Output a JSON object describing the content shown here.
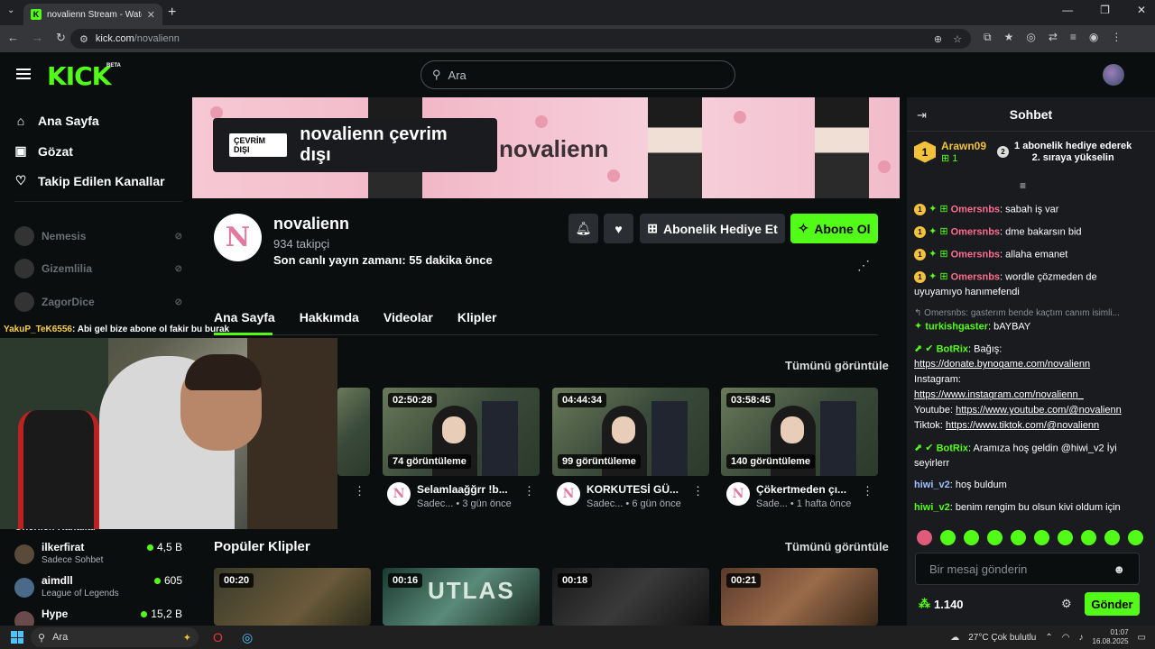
{
  "browser": {
    "tab_title": "novalienn Stream - Watch Live",
    "url_domain": "kick.com",
    "url_path": "/novalienn"
  },
  "header": {
    "logo": "KICK",
    "beta": "BETA",
    "search_placeholder": "Ara"
  },
  "sidebar": {
    "nav": [
      {
        "label": "Ana Sayfa",
        "icon": "home-icon"
      },
      {
        "label": "Gözat",
        "icon": "browse-icon"
      },
      {
        "label": "Takip Edilen Kanallar",
        "icon": "heart-icon"
      }
    ],
    "offline_channels": [
      "Nemesis",
      "Gizemlilia",
      "ZagorDice"
    ],
    "recommended_header": "Önerilen Kanallar",
    "recommended": [
      {
        "name": "ilkerfirat",
        "category": "Sadece Sohbet",
        "viewers": "4,5 B"
      },
      {
        "name": "aimdll",
        "category": "League of Legends",
        "viewers": "605"
      },
      {
        "name": "Hype",
        "category": "",
        "viewers": "15,2 B"
      }
    ]
  },
  "webcam_caption": {
    "user": "YakuP_TeK6556",
    "message": ": Abi gel bize abone ol fakir bu burak"
  },
  "banner": {
    "offline_badge": "ÇEVRİM DIŞI",
    "offline_text": "novalienn çevrim dışı",
    "watermark": "novalienn"
  },
  "profile": {
    "name": "novalienn",
    "followers": "934 takipçi",
    "last_live": "Son canlı yayın zamanı: 55 dakika önce",
    "gift_button": "Abonelik Hediye Et",
    "subscribe_button": "Abone Ol"
  },
  "tabs": [
    "Ana Sayfa",
    "Hakkımda",
    "Videolar",
    "Klipler"
  ],
  "videos_section": {
    "see_all": "Tümünü görüntüle",
    "items": [
      {
        "duration": "02:50:28",
        "views": "74 görüntüleme",
        "title": "Selamlaağğrr !b...",
        "channel": "Sadec...",
        "age": "• 3 gün önce"
      },
      {
        "duration": "04:44:34",
        "views": "99 görüntüleme",
        "title": "KORKUTESİ GÜ...",
        "channel": "Sadec...",
        "age": "• 6 gün önce"
      },
      {
        "duration": "03:58:45",
        "views": "140 görüntüleme",
        "title": "Çökertmeden çı...",
        "channel": "Sade...",
        "age": "• 1 hafta önce"
      }
    ]
  },
  "clips_section": {
    "title": "Popüler Klipler",
    "see_all": "Tümünü görüntüle",
    "items": [
      {
        "duration": "00:20"
      },
      {
        "duration": "00:16"
      },
      {
        "duration": "00:18"
      },
      {
        "duration": "00:21"
      }
    ]
  },
  "chat": {
    "title": "Sohbet",
    "pinned": {
      "user": "Arawn09",
      "count": "1",
      "rank": "2",
      "message_line1": "1 abonelik hediye ederek",
      "message_line2": "2. sıraya yükselin"
    },
    "messages": [
      {
        "user": "Omersnbs",
        "text": ": sabah iş var"
      },
      {
        "user": "Omersnbs",
        "text": ": dme bakarsın bid"
      },
      {
        "user": "Omersnbs",
        "text": ": allaha emanet"
      },
      {
        "user": "Omersnbs",
        "text": ": wordle çözmeden de uyuyamıyo hanımefendi"
      }
    ],
    "reply_preview": "Omersnbs: gasterım bende kaçtım canım isimli...",
    "reply_user": "turkishgaster",
    "reply_text": ": bAYBAY",
    "botrix1": {
      "user": "BotRix",
      "label": ": Bağış:",
      "link1": "https://donate.bynogame.com/novalienn",
      "ig_label": "Instagram:",
      "link2": "https://www.instagram.com/novalienn_",
      "yt_label": "Youtube: ",
      "link3": "https://www.youtube.com/@novalienn",
      "tt_label": "Tiktok: ",
      "link4": "https://www.tiktok.com/@novalienn"
    },
    "botrix2": {
      "user": "BotRix",
      "text": ": Aramıza hoş geldin @hiwi_v2 İyi seyirlerr"
    },
    "hiwi1": {
      "user": "hiwi_v2",
      "text": ": hoş buldum"
    },
    "hiwi2": {
      "user": "hiwi_v2",
      "text": ": benim rengim bu olsun kivi oldum için"
    },
    "input_placeholder": "Bir mesaj gönderin",
    "points": "1.140",
    "send": "Gönder"
  },
  "taskbar": {
    "search": "Ara",
    "weather": "27°C  Çok bulutlu",
    "time": "01:07",
    "date": "16.08.2025"
  },
  "colors": {
    "accent": "#53fc18",
    "bg": "#0b0e0f",
    "chat_bg": "#191b1f"
  }
}
